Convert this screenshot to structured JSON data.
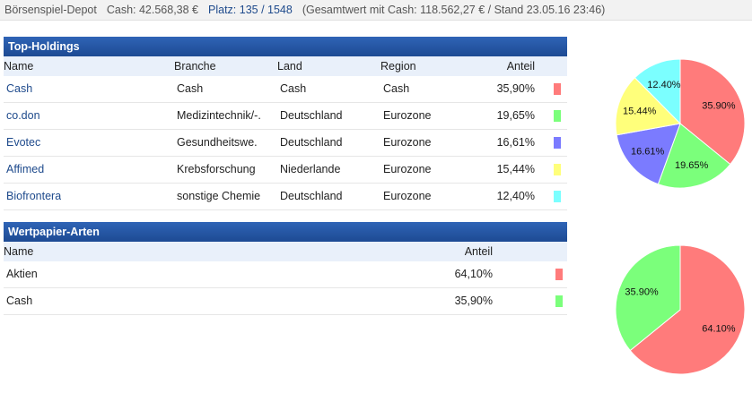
{
  "topbar": {
    "title": "Börsenspiel-Depot",
    "cash": "Cash: 42.568,38 €",
    "rank": "Platz: 135 / 1548",
    "total": "(Gesamtwert mit Cash: 118.562,27 € / Stand 23.05.16 23:46)"
  },
  "holdings": {
    "title": "Top-Holdings",
    "headers": {
      "name": "Name",
      "branche": "Branche",
      "land": "Land",
      "region": "Region",
      "anteil": "Anteil"
    },
    "rows": [
      {
        "name": "Cash",
        "branche": "Cash",
        "land": "Cash",
        "region": "Cash",
        "anteil": "35,90%",
        "color": "#ff7b7b"
      },
      {
        "name": "co.don",
        "branche": "Medizintechnik/-.",
        "land": "Deutschland",
        "region": "Eurozone",
        "anteil": "19,65%",
        "color": "#7bff7b"
      },
      {
        "name": "Evotec",
        "branche": "Gesundheitswe.",
        "land": "Deutschland",
        "region": "Eurozone",
        "anteil": "16,61%",
        "color": "#7b7bff"
      },
      {
        "name": "Affimed",
        "branche": "Krebsforschung",
        "land": "Niederlande",
        "region": "Eurozone",
        "anteil": "15,44%",
        "color": "#ffff7b"
      },
      {
        "name": "Biofrontera",
        "branche": "sonstige Chemie",
        "land": "Deutschland",
        "region": "Eurozone",
        "anteil": "12,40%",
        "color": "#7bffff"
      }
    ]
  },
  "types": {
    "title": "Wertpapier-Arten",
    "headers": {
      "name": "Name",
      "anteil": "Anteil"
    },
    "rows": [
      {
        "name": "Aktien",
        "anteil": "64,10%",
        "color": "#ff7b7b"
      },
      {
        "name": "Cash",
        "anteil": "35,90%",
        "color": "#7bff7b"
      }
    ]
  },
  "pie1": {
    "slices": [
      {
        "value": 35.9,
        "label": "35.90%",
        "color": "#ff7b7b"
      },
      {
        "value": 19.65,
        "label": "19.65%",
        "color": "#7bff7b"
      },
      {
        "value": 16.61,
        "label": "16.61%",
        "color": "#7b7bff"
      },
      {
        "value": 15.44,
        "label": "15.44%",
        "color": "#ffff7b"
      },
      {
        "value": 12.4,
        "label": "12.40%",
        "color": "#7bffff"
      }
    ]
  },
  "pie2": {
    "slices": [
      {
        "value": 64.1,
        "label": "64.10%",
        "color": "#ff7b7b"
      },
      {
        "value": 35.9,
        "label": "35.90%",
        "color": "#7bff7b"
      }
    ]
  }
}
